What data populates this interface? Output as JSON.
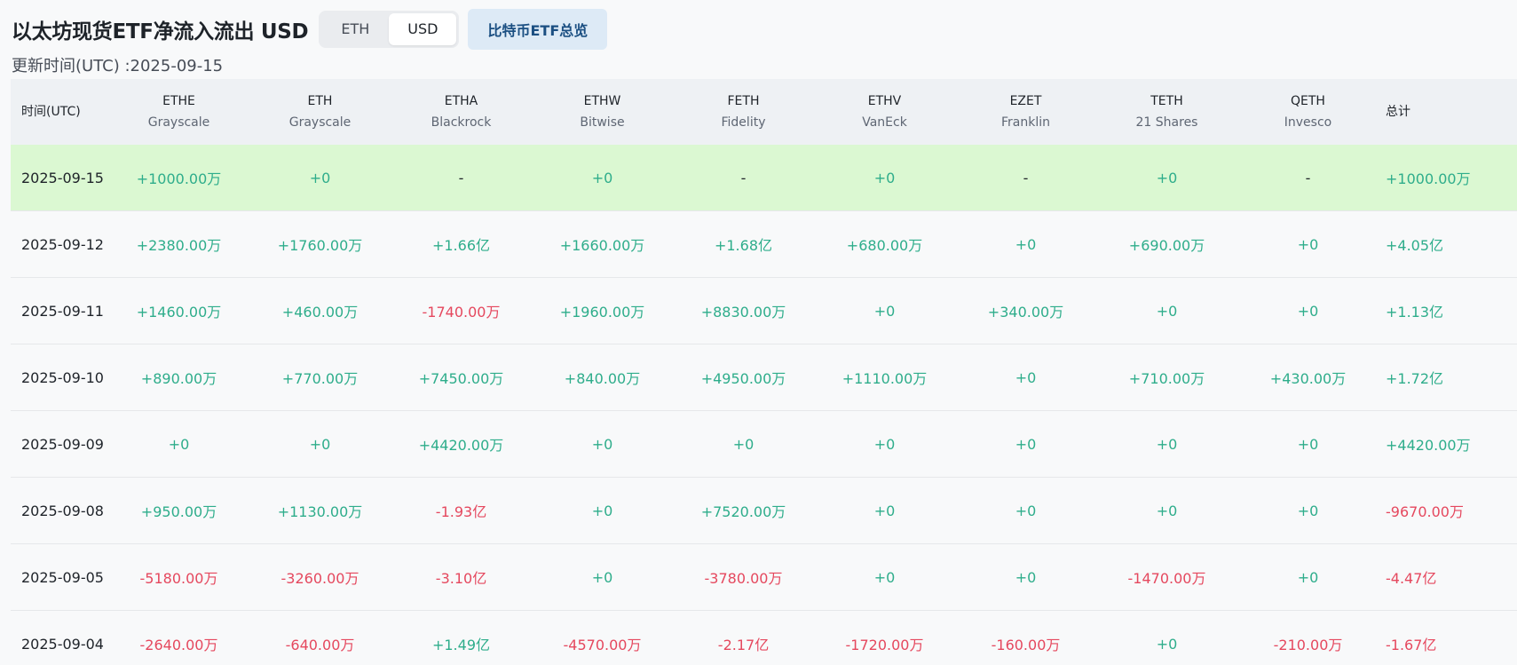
{
  "header": {
    "title": "以太坊现货ETF净流入流出 USD",
    "toggle": [
      "ETH",
      "USD"
    ],
    "toggle_active": "USD",
    "overview_button": "比特币ETF总览",
    "update_time": "更新时间(UTC) :2025-09-15"
  },
  "colors": {
    "positive": "#2ead8b",
    "negative": "#e5485e",
    "highlight_row": "#dbf8d2",
    "header_bg": "#eef1f4",
    "overview_button_bg": "#ddeaf6"
  },
  "table": {
    "date_header": "时间(UTC)",
    "total_header": "总计",
    "funds": [
      {
        "ticker": "ETHE",
        "issuer": "Grayscale"
      },
      {
        "ticker": "ETH",
        "issuer": "Grayscale"
      },
      {
        "ticker": "ETHA",
        "issuer": "Blackrock"
      },
      {
        "ticker": "ETHW",
        "issuer": "Bitwise"
      },
      {
        "ticker": "FETH",
        "issuer": "Fidelity"
      },
      {
        "ticker": "ETHV",
        "issuer": "VanEck"
      },
      {
        "ticker": "EZET",
        "issuer": "Franklin"
      },
      {
        "ticker": "TETH",
        "issuer": "21 Shares"
      },
      {
        "ticker": "QETH",
        "issuer": "Invesco"
      }
    ],
    "rows": [
      {
        "date": "2025-09-15",
        "highlight": true,
        "values": [
          "+1000.00万",
          "+0",
          "-",
          "+0",
          "-",
          "+0",
          "-",
          "+0",
          "-"
        ],
        "total": "+1000.00万"
      },
      {
        "date": "2025-09-12",
        "highlight": false,
        "values": [
          "+2380.00万",
          "+1760.00万",
          "+1.66亿",
          "+1660.00万",
          "+1.68亿",
          "+680.00万",
          "+0",
          "+690.00万",
          "+0"
        ],
        "total": "+4.05亿"
      },
      {
        "date": "2025-09-11",
        "highlight": false,
        "values": [
          "+1460.00万",
          "+460.00万",
          "-1740.00万",
          "+1960.00万",
          "+8830.00万",
          "+0",
          "+340.00万",
          "+0",
          "+0"
        ],
        "total": "+1.13亿"
      },
      {
        "date": "2025-09-10",
        "highlight": false,
        "values": [
          "+890.00万",
          "+770.00万",
          "+7450.00万",
          "+840.00万",
          "+4950.00万",
          "+1110.00万",
          "+0",
          "+710.00万",
          "+430.00万"
        ],
        "total": "+1.72亿"
      },
      {
        "date": "2025-09-09",
        "highlight": false,
        "values": [
          "+0",
          "+0",
          "+4420.00万",
          "+0",
          "+0",
          "+0",
          "+0",
          "+0",
          "+0"
        ],
        "total": "+4420.00万"
      },
      {
        "date": "2025-09-08",
        "highlight": false,
        "values": [
          "+950.00万",
          "+1130.00万",
          "-1.93亿",
          "+0",
          "+7520.00万",
          "+0",
          "+0",
          "+0",
          "+0"
        ],
        "total": "-9670.00万"
      },
      {
        "date": "2025-09-05",
        "highlight": false,
        "values": [
          "-5180.00万",
          "-3260.00万",
          "-3.10亿",
          "+0",
          "-3780.00万",
          "+0",
          "+0",
          "-1470.00万",
          "+0"
        ],
        "total": "-4.47亿"
      },
      {
        "date": "2025-09-04",
        "highlight": false,
        "values": [
          "-2640.00万",
          "-640.00万",
          "+1.49亿",
          "-4570.00万",
          "-2.17亿",
          "-1720.00万",
          "-160.00万",
          "+0",
          "-210.00万"
        ],
        "total": "-1.67亿"
      }
    ]
  }
}
